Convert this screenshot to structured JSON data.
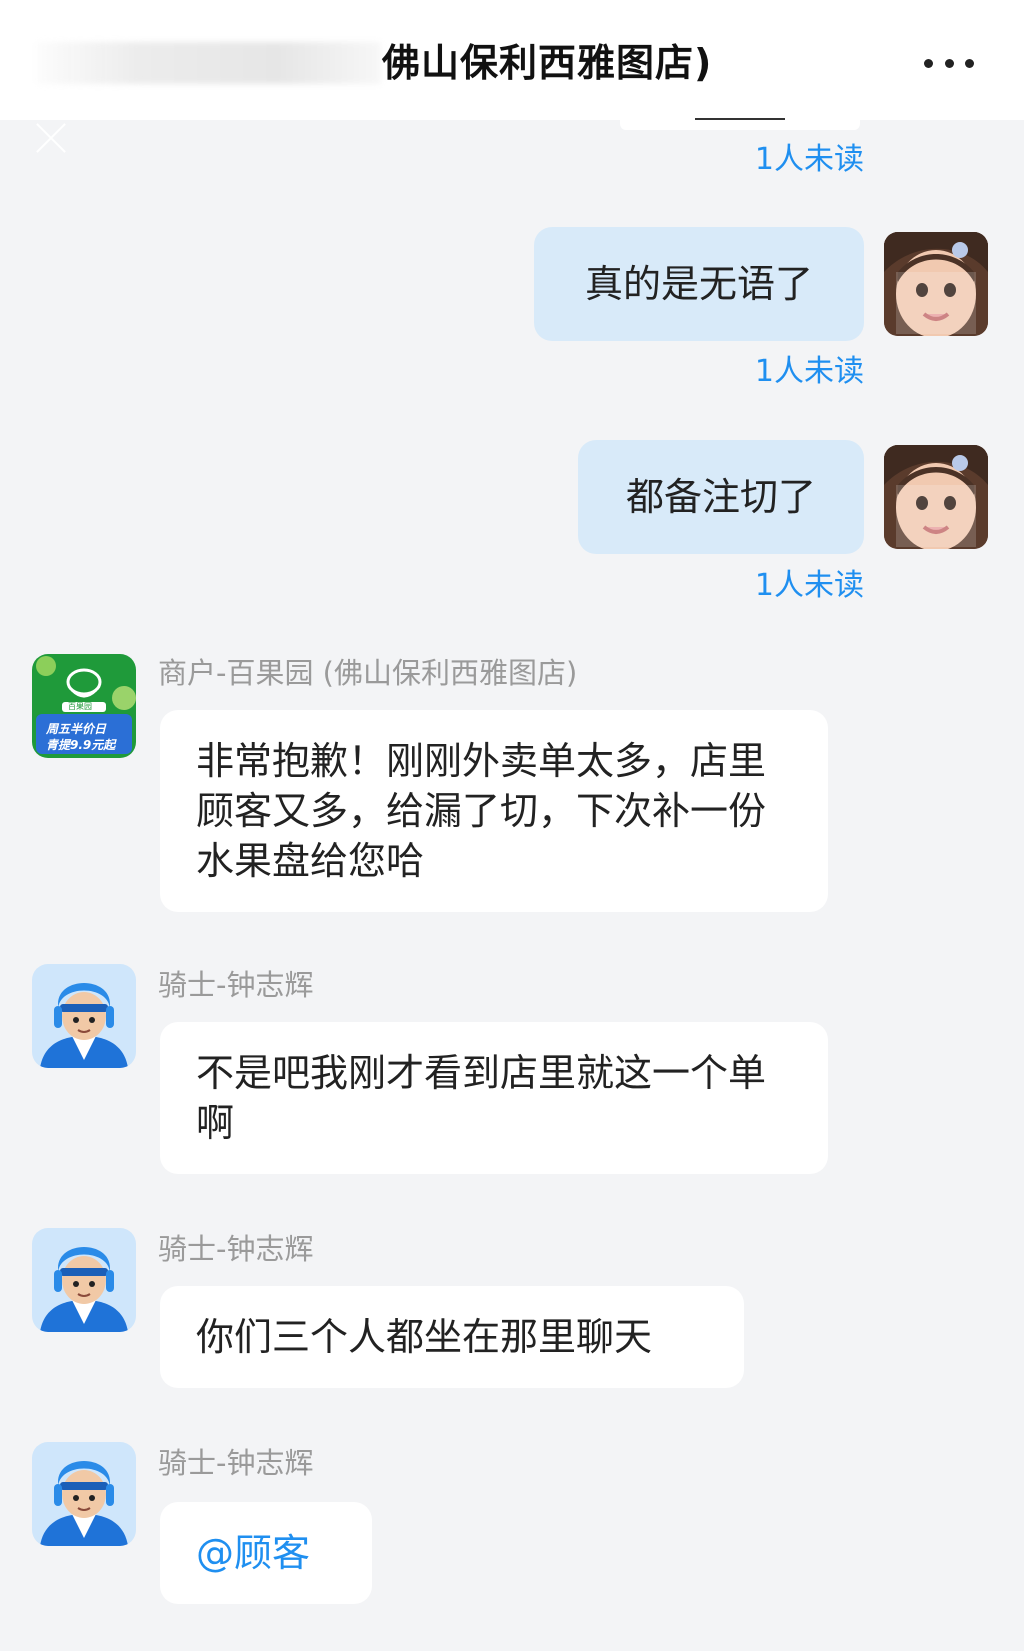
{
  "header": {
    "title": "佛山保利西雅图店)",
    "more_label": "更多"
  },
  "messages_out": [
    {
      "text": "真的是无语了",
      "status": "1人未读"
    },
    {
      "text": "都备注切了",
      "status": "1人未读"
    }
  ],
  "top_status": "1人未读",
  "merchant": {
    "sender": "商户-百果园 (佛山保利西雅图店)",
    "text": "非常抱歉！刚刚外卖单太多，店里顾客又多，给漏了切，下次补一份水果盘给您哈",
    "logo_lines": [
      "百果园",
      "周五半价日",
      "青提9.9元起"
    ]
  },
  "rider_messages": [
    {
      "sender": "骑士-钟志辉",
      "text": "不是吧我刚才看到店里就这一个单啊"
    },
    {
      "sender": "骑士-钟志辉",
      "text": "你们三个人都坐在那里聊天"
    },
    {
      "sender": "骑士-钟志辉",
      "text": "@顾客"
    }
  ],
  "colors": {
    "accent": "#1f8ff0",
    "outgoing_bubble": "#d8eaf9",
    "background": "#f3f4f6"
  }
}
